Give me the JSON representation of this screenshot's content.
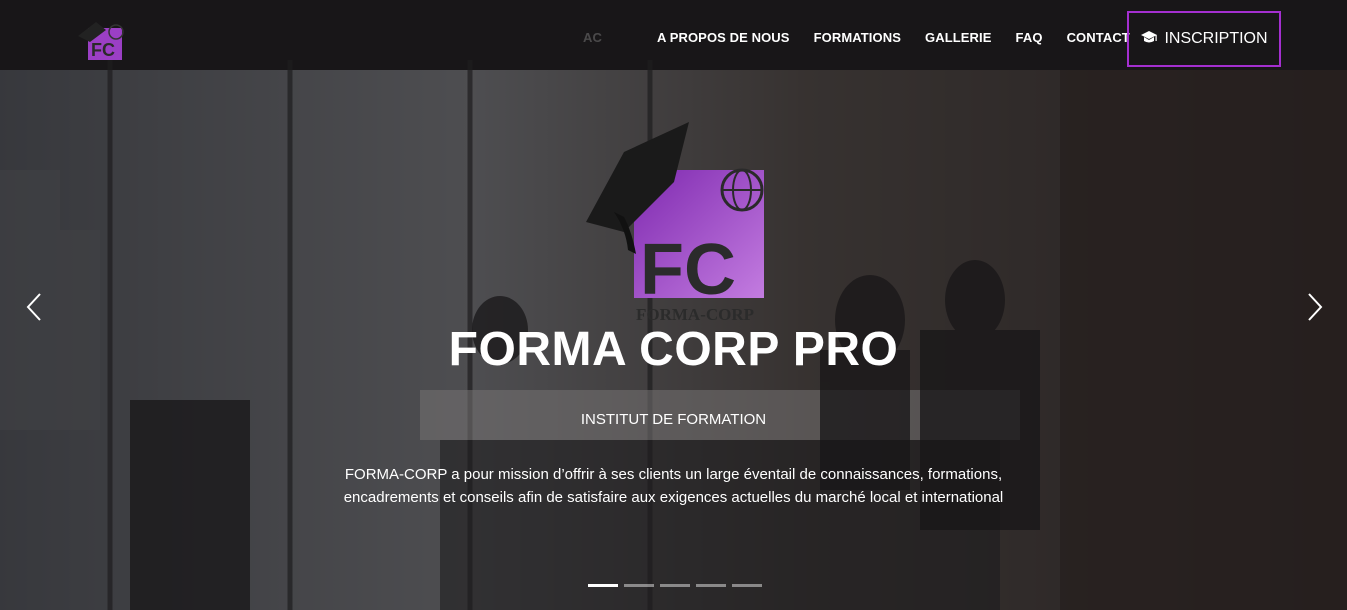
{
  "nav": {
    "ghost_item": "AC",
    "items": [
      "A PROPOS DE NOUS",
      "FORMATIONS",
      "GALLERIE",
      "FAQ",
      "CONTACT"
    ],
    "cta_label": "INSCRIPTION"
  },
  "hero": {
    "logo_text": "FORMA-CORP",
    "logo_letters": "FC",
    "title": "FORMA CORP PRO",
    "subtitle": "INSTITUT DE FORMATION",
    "description": "FORMA-CORP a pour mission d’offrir à ses clients un large éventail de connaissances, formations, encadrements et conseils afin de satisfaire aux exigences actuelles du marché local et international"
  },
  "carousel": {
    "slides": 5,
    "active_index": 0
  },
  "colors": {
    "accent": "#a42fd0",
    "logo_purple": "#9b3fc5"
  },
  "icons": [
    "graduation-cap-icon",
    "chevron-left-icon",
    "chevron-right-icon",
    "globe-icon"
  ]
}
